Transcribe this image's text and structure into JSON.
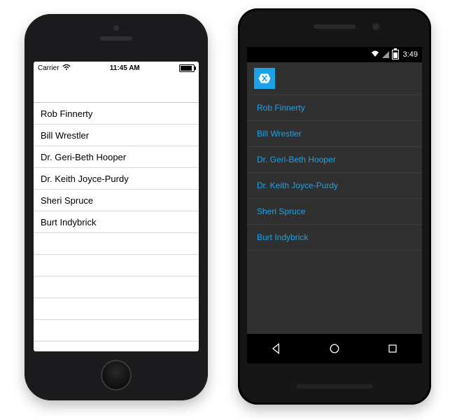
{
  "list": {
    "items": [
      {
        "name": "Rob Finnerty"
      },
      {
        "name": "Bill Wrestler"
      },
      {
        "name": "Dr. Geri-Beth Hooper"
      },
      {
        "name": "Dr. Keith Joyce-Purdy"
      },
      {
        "name": "Sheri Spruce"
      },
      {
        "name": "Burt Indybrick"
      }
    ]
  },
  "ios": {
    "status": {
      "carrier": "Carrier",
      "time": "11:45 AM"
    },
    "accent": "#000000"
  },
  "android": {
    "status": {
      "time": "3:49"
    },
    "accent": "#1aa3e8"
  }
}
